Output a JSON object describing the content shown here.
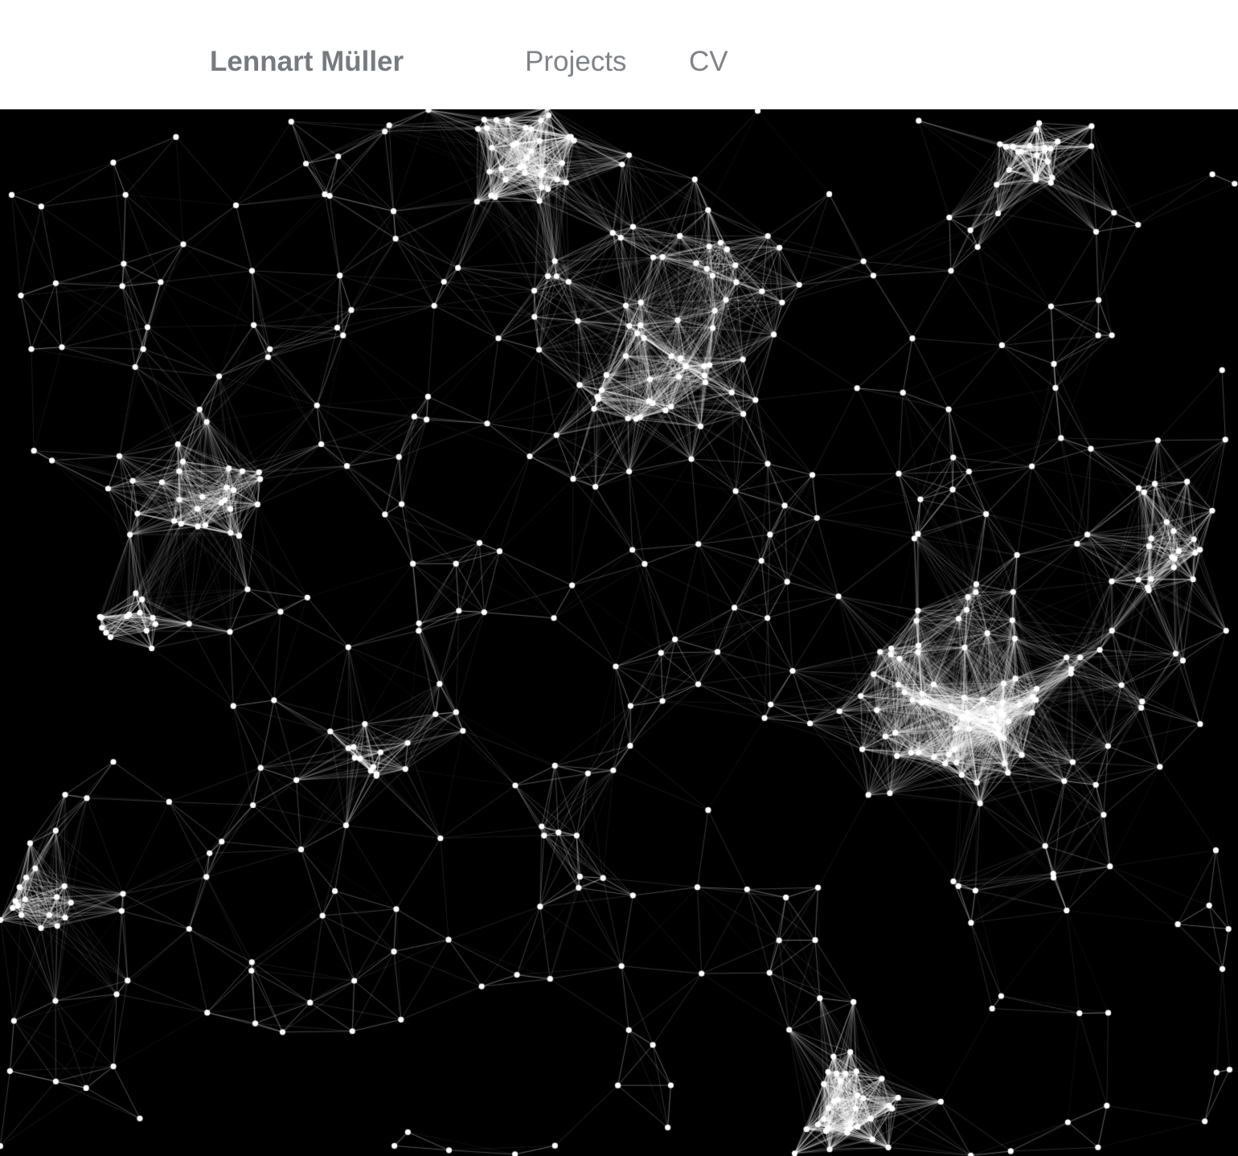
{
  "header": {
    "brand": "Lennart Müller",
    "nav": [
      {
        "label": "Projects"
      },
      {
        "label": "CV"
      }
    ]
  },
  "hero": {
    "background_color": "#000000",
    "node_color": "#ffffff",
    "link_color": "#ffffff",
    "content": "animated particle network (plexus) of white nodes connected by thin lines"
  },
  "colors": {
    "header_background": "#ffffff",
    "brand_text": "#777b80",
    "nav_text": "#7f8388"
  }
}
